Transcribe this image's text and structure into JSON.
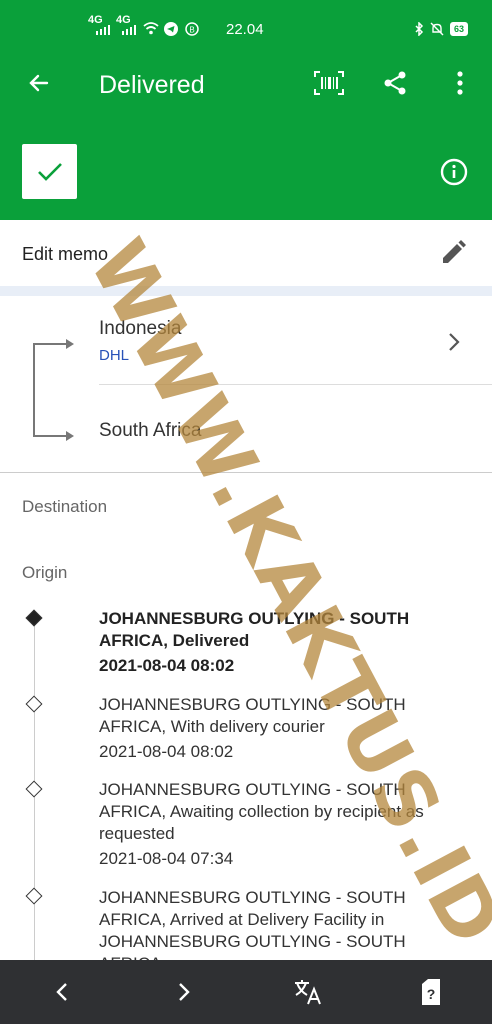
{
  "status_bar": {
    "signal1": "4G",
    "signal2": "4G",
    "time": "22.04",
    "battery": "63"
  },
  "app_bar": {
    "title": "Delivered"
  },
  "memo": {
    "label": "Edit memo"
  },
  "route": {
    "origin_country": "Indonesia",
    "carrier": "DHL",
    "destination_country": "South Africa"
  },
  "sections": {
    "destination": "Destination",
    "origin": "Origin"
  },
  "events": [
    {
      "text": "JOHANNESBURG OUTLYING - SOUTH AFRICA, Delivered",
      "date": "2021-08-04 08:02"
    },
    {
      "text": "JOHANNESBURG OUTLYING - SOUTH AFRICA, With delivery courier",
      "date": "2021-08-04 08:02"
    },
    {
      "text": "JOHANNESBURG OUTLYING - SOUTH AFRICA, Awaiting collection by recipient as requested",
      "date": "2021-08-04 07:34"
    },
    {
      "text": "JOHANNESBURG OUTLYING - SOUTH AFRICA, Arrived at Delivery Facility in JOHANNESBURG OUTLYING - SOUTH AFRICA",
      "date": ""
    }
  ],
  "watermark": "WWW.KAKTUS.ID",
  "colors": {
    "primary": "#0aa03a",
    "carrier_link": "#2952b8",
    "nav_bar": "#2f3033"
  }
}
